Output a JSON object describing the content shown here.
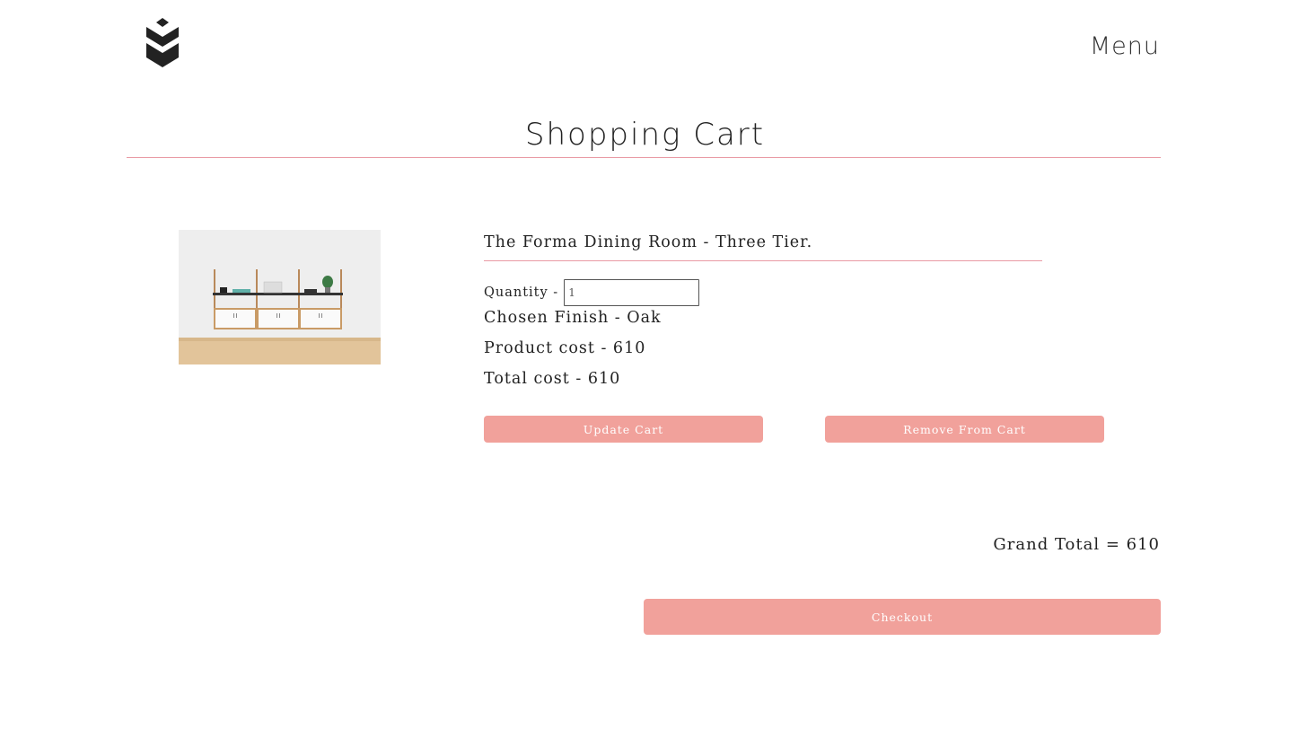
{
  "header": {
    "menu_label": "Menu"
  },
  "page": {
    "title": "Shopping Cart"
  },
  "cart_item": {
    "name": "The Forma Dining Room - Three Tier.",
    "quantity_label": "Quantity -",
    "quantity_value": "1",
    "finish_line": "Chosen Finish - Oak",
    "product_cost_line": "Product cost - 610",
    "total_cost_line": "Total cost - 610",
    "update_label": "Update Cart",
    "remove_label": "Remove From Cart"
  },
  "summary": {
    "grand_total_line": "Grand Total = 610",
    "checkout_label": "Checkout"
  },
  "colors": {
    "accent": "#f1a19b",
    "rule": "#e99aa4"
  },
  "icons": {
    "logo": "stacked-chevron-logo-icon"
  }
}
